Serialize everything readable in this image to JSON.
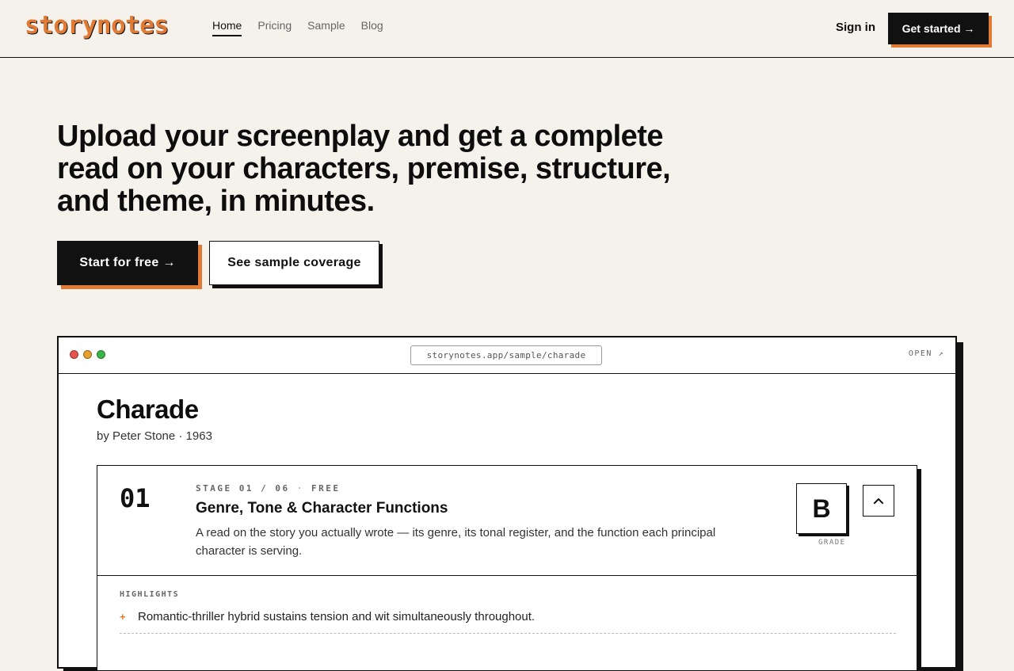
{
  "nav": {
    "logo": "storynotes",
    "links": [
      "Home",
      "Pricing",
      "Sample",
      "Blog"
    ],
    "sign_in": "Sign in",
    "get_started": "Get started →"
  },
  "hero": {
    "title": "Upload your screenplay and get a complete read on your characters, premise, structure, and theme, in minutes.",
    "primary_cta": "Start for free →",
    "secondary_cta": "See sample coverage"
  },
  "browser": {
    "url": "storynotes.app/sample/charade",
    "open": "OPEN ↗",
    "dot_colors": [
      "#e5534b",
      "#e5a02e",
      "#3bb54a"
    ]
  },
  "document": {
    "title": "Charade",
    "byline": "by Peter Stone · 1963"
  },
  "stage": {
    "number": "01",
    "label_stage": "STAGE 01 / 06",
    "label_sep": "·",
    "label_tier": "FREE",
    "name": "Genre, Tone & Character Functions",
    "description": "A read on the story you actually wrote — its genre, its tonal register, and the function each principal character is serving.",
    "grade": "B",
    "grade_label": "GRADE",
    "highlights_label": "HIGHLIGHTS",
    "highlights": [
      "Romantic-thriller hybrid sustains tension and wit simultaneously throughout."
    ]
  },
  "colors": {
    "accent": "#e07a34",
    "background": "#f5f2ec",
    "ink": "#111111"
  }
}
